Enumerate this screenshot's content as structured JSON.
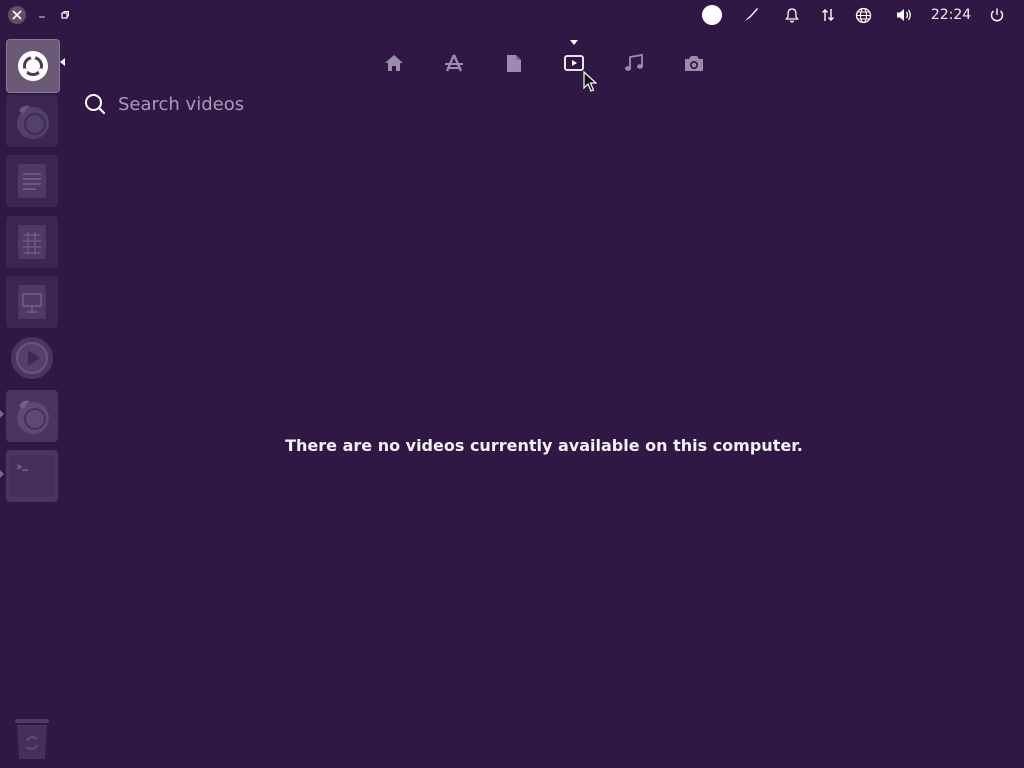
{
  "topbar": {
    "clock": "22:24",
    "indicators": [
      "user-status-icon",
      "pen-icon",
      "bell-icon",
      "network-transfer-icon",
      "globe-icon",
      "volume-icon",
      "power-icon"
    ]
  },
  "window_controls": [
    "close-icon",
    "minimize-icon",
    "restore-icon"
  ],
  "launcher": {
    "items": [
      {
        "name": "dash-home",
        "icon": "ubuntu-logo-icon",
        "active": true
      },
      {
        "name": "firefox",
        "icon": "firefox-icon"
      },
      {
        "name": "writer",
        "icon": "document-writer-icon"
      },
      {
        "name": "calc",
        "icon": "spreadsheet-icon"
      },
      {
        "name": "impress",
        "icon": "presentation-icon"
      },
      {
        "name": "media-player",
        "icon": "media-player-icon"
      },
      {
        "name": "firefox-running",
        "icon": "firefox-icon",
        "running": true
      },
      {
        "name": "terminal",
        "icon": "terminal-icon",
        "running": true
      },
      {
        "name": "trash",
        "icon": "trash-icon"
      }
    ]
  },
  "lenses": [
    {
      "name": "home",
      "icon": "home-icon"
    },
    {
      "name": "applications",
      "icon": "applications-icon"
    },
    {
      "name": "files",
      "icon": "file-icon"
    },
    {
      "name": "videos",
      "icon": "video-icon",
      "active": true
    },
    {
      "name": "music",
      "icon": "music-icon"
    },
    {
      "name": "photos",
      "icon": "camera-icon"
    }
  ],
  "search": {
    "placeholder": "Search videos",
    "value": ""
  },
  "main": {
    "empty_message": "There are no videos currently available on this computer."
  },
  "colors": {
    "background": "#2f1944",
    "icon_muted": "#9a8cab",
    "icon_active": "#ffffff"
  }
}
